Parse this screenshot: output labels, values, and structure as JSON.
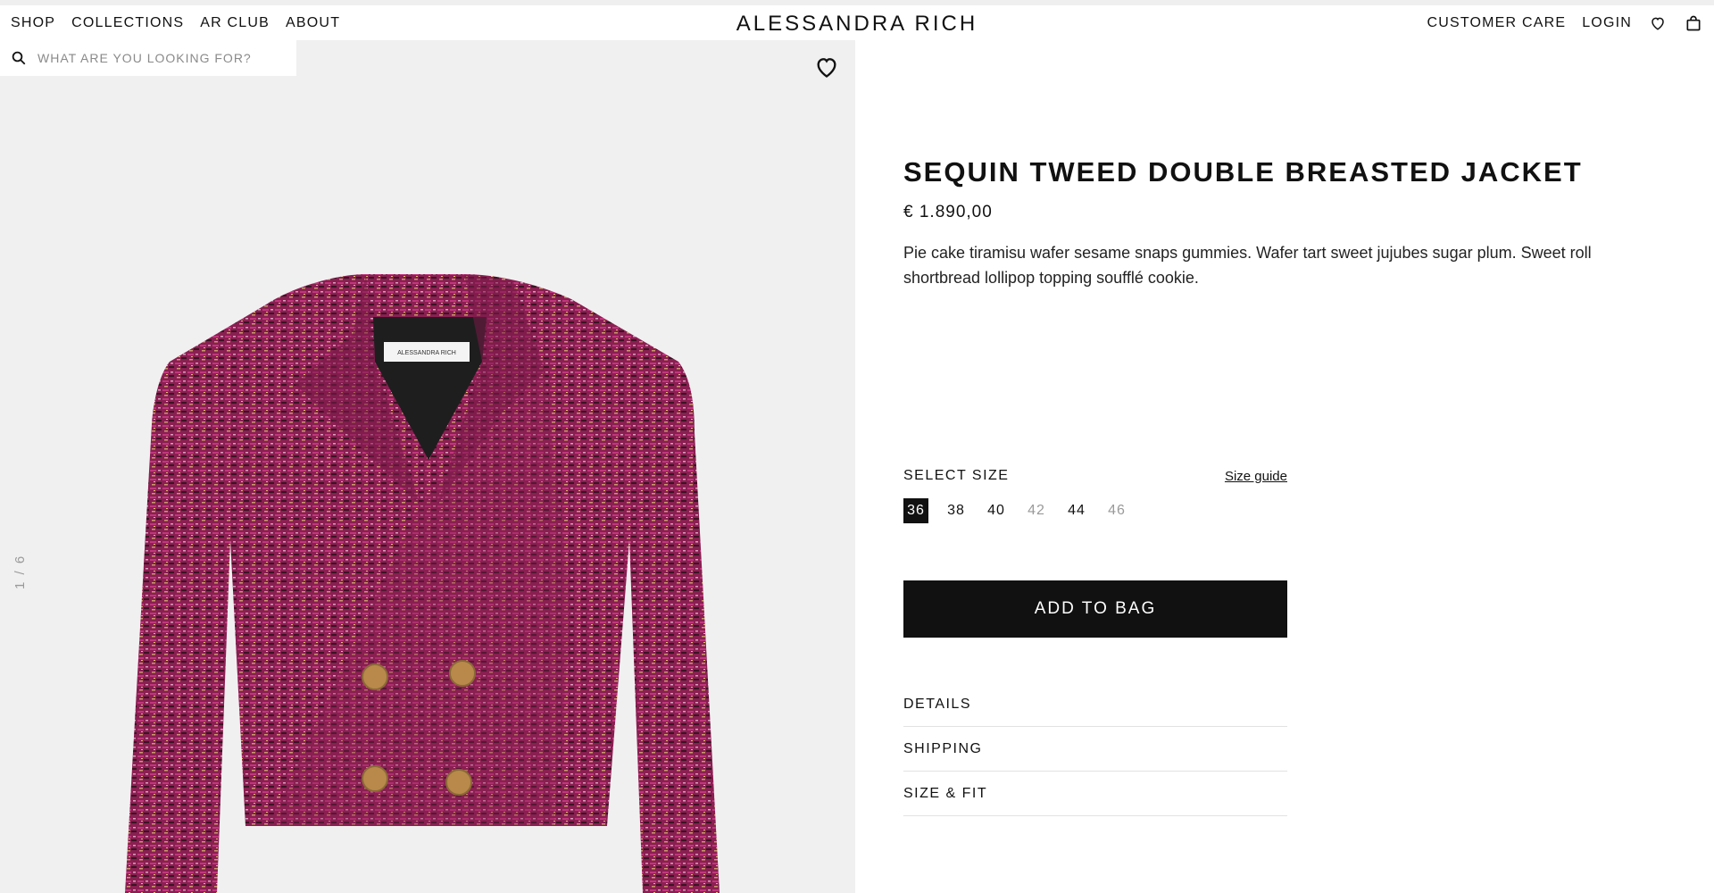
{
  "header": {
    "nav_left": [
      "SHOP",
      "COLLECTIONS",
      "AR CLUB",
      "ABOUT"
    ],
    "brand": "ALESSANDRA RICH",
    "nav_right": {
      "customer_care": "CUSTOMER CARE",
      "login": "LOGIN"
    }
  },
  "search": {
    "placeholder": "WHAT ARE YOU LOOKING FOR?"
  },
  "gallery": {
    "counter": "1 / 6",
    "colors": {
      "background": "#f0f0f0",
      "fabric": "#8a1f52",
      "buttons": "#b8894a"
    }
  },
  "product": {
    "title": "SEQUIN TWEED DOUBLE BREASTED JACKET",
    "price": "€ 1.890,00",
    "description": "Pie cake tiramisu wafer sesame snaps gummies. Wafer tart sweet jujubes sugar plum. Sweet roll shortbread lollipop topping soufflé cookie.",
    "label_text": "ALESSANDRA RICH"
  },
  "size_selector": {
    "label": "SELECT SIZE",
    "guide": "Size guide",
    "sizes": [
      {
        "value": "36",
        "state": "selected"
      },
      {
        "value": "38",
        "state": "available"
      },
      {
        "value": "40",
        "state": "available"
      },
      {
        "value": "42",
        "state": "unavailable"
      },
      {
        "value": "44",
        "state": "available"
      },
      {
        "value": "46",
        "state": "unavailable"
      }
    ]
  },
  "cta": {
    "add_to_bag": "ADD TO BAG"
  },
  "accordion": [
    "DETAILS",
    "SHIPPING",
    "SIZE & FIT"
  ]
}
